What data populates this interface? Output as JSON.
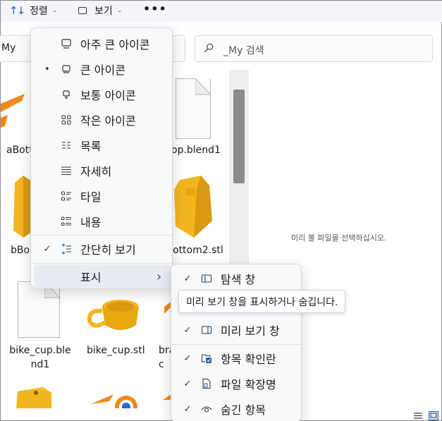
{
  "toolbar": {
    "sort_label": "정렬",
    "view_label": "보기",
    "more_label": "•••"
  },
  "address": {
    "text": "My"
  },
  "search": {
    "placeholder": "_My 검색"
  },
  "files": [
    {
      "name": "aBott"
    },
    {
      "name": "op.blend1"
    },
    {
      "name": "bBo"
    },
    {
      "name": "ottom2.stl"
    },
    {
      "name": "bike_cup.ble\nnd1"
    },
    {
      "name": "bike_cup.stl"
    },
    {
      "name": "bra\nc"
    }
  ],
  "preview_message": "미리 볼 파일을 선택하십시오.",
  "view_menu": {
    "items": [
      {
        "label": "아주 큰 아이콘",
        "mark": "",
        "icon": "monitor-large-icon"
      },
      {
        "label": "큰 아이콘",
        "mark": "•",
        "icon": "monitor-icon"
      },
      {
        "label": "보통 아이콘",
        "mark": "",
        "icon": "monitor-small-icon"
      },
      {
        "label": "작은 아이콘",
        "mark": "",
        "icon": "small-icons-grid-icon"
      },
      {
        "label": "목록",
        "mark": "",
        "icon": "list-icon"
      },
      {
        "label": "자세히",
        "mark": "",
        "icon": "details-icon"
      },
      {
        "label": "타일",
        "mark": "",
        "icon": "tiles-icon"
      },
      {
        "label": "내용",
        "mark": "",
        "icon": "content-icon"
      },
      {
        "label": "간단히 보기",
        "mark": "✓",
        "icon": "compact-view-icon"
      },
      {
        "label": "표시",
        "mark": "",
        "icon": "",
        "chevron": "›"
      }
    ]
  },
  "show_submenu": {
    "items": [
      {
        "label": "탐색 창",
        "mark": "✓",
        "icon": "navigation-pane-icon"
      },
      {
        "label": "미리 보기 창",
        "mark": "✓",
        "icon": "preview-pane-icon"
      },
      {
        "label": "항목 확인란",
        "mark": "✓",
        "icon": "item-checkbox-icon"
      },
      {
        "label": "파일 확장명",
        "mark": "✓",
        "icon": "file-extension-icon"
      },
      {
        "label": "숨긴 항목",
        "mark": "✓",
        "icon": "hidden-items-icon"
      }
    ]
  },
  "tooltip": "미리 보기 창을 표시하거나 숨깁니다.",
  "colors": {
    "accent": "#1c64b4",
    "blender_orange": "#f08a1c",
    "model_yellow": "#f2b620"
  }
}
